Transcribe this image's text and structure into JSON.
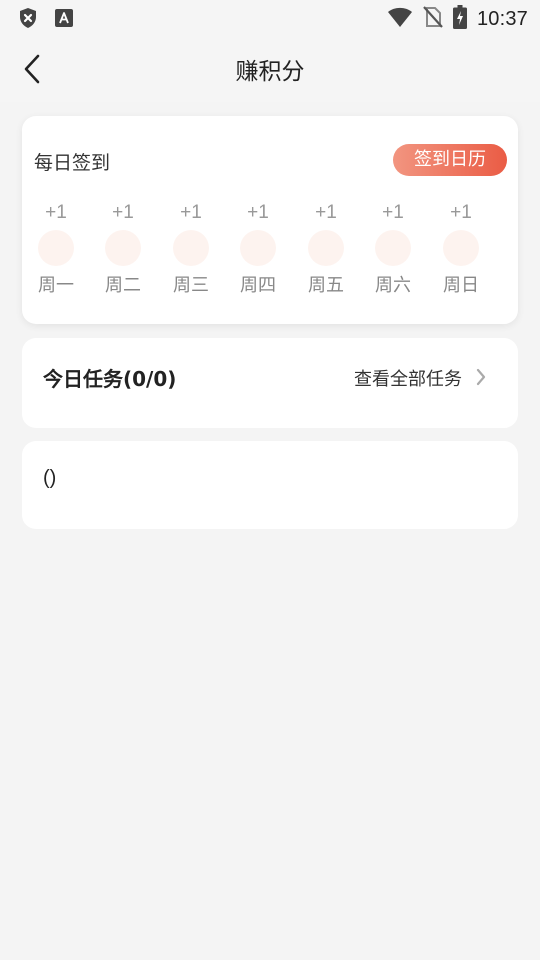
{
  "status_bar": {
    "time": "10:37",
    "left_icons": [
      "shield-x-icon",
      "text-a-icon"
    ],
    "right_icons": [
      "wifi-icon",
      "no-sim-icon",
      "battery-charging-icon"
    ]
  },
  "nav": {
    "title": "赚积分",
    "back_icon": "chevron-left-icon"
  },
  "checkin": {
    "title": "每日签到",
    "calendar_button": "签到日历",
    "accent_gradient": [
      "#f29580",
      "#ea5c45"
    ],
    "days": [
      {
        "points": "+1",
        "name": "周一"
      },
      {
        "points": "+1",
        "name": "周二"
      },
      {
        "points": "+1",
        "name": "周三"
      },
      {
        "points": "+1",
        "name": "周四"
      },
      {
        "points": "+1",
        "name": "周五"
      },
      {
        "points": "+1",
        "name": "周六"
      },
      {
        "points": "+1",
        "name": "周日"
      }
    ]
  },
  "tasks": {
    "title": "今日任务(0/0)",
    "view_all": "查看全部任务",
    "chevron_icon": "chevron-right-icon"
  },
  "empty_card": {
    "text": "()"
  }
}
